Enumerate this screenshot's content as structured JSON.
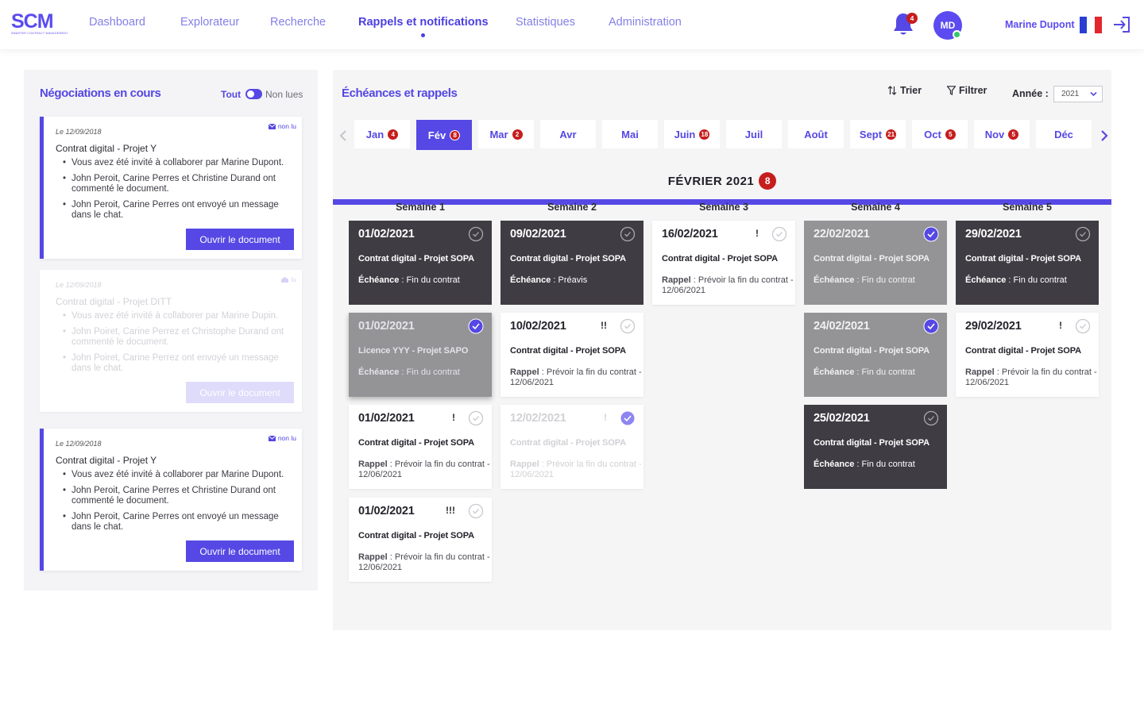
{
  "app": {
    "logo_text": "SCM",
    "logo_subtitle": "SMARTER CONTRACT MANAGEMENT"
  },
  "nav": [
    {
      "label": "Dashboard",
      "active": false
    },
    {
      "label": "Explorateur",
      "active": false
    },
    {
      "label": "Recherche",
      "active": false
    },
    {
      "label": "Rappels et notifications",
      "active": true
    },
    {
      "label": "Statistiques",
      "active": false
    },
    {
      "label": "Administration",
      "active": false
    }
  ],
  "header": {
    "notification_count": "4",
    "avatar_initials": "MD",
    "user_name": "Marine Dupont",
    "icons": {
      "bell": "bell-icon",
      "flag": "french-flag-icon",
      "logout": "logout-icon"
    }
  },
  "negotiations": {
    "title": "Négociations en cours",
    "filter_all": "Tout",
    "filter_unread": "Non lues",
    "cards": [
      {
        "date": "Le 12/09/2018",
        "unread_label": "non lu",
        "title": "Contrat digital - Projet Y",
        "items": [
          "Vous avez été invité à collaborer par Marine Dupont.",
          "John Peroit, Carine Perres et Christine Durand ont commenté le document.",
          "John Peroit, Carine Perres ont envoyé un message dans le chat."
        ],
        "button": "Ouvrir le document"
      },
      {
        "date": "Le 12/09/2018",
        "unread_label": "lu",
        "title": "Contrat digital - Projet DITT",
        "items": [
          "Vous avez été invité à collaborer par Marine Dupin.",
          "John Poiret, Carine Perrez et Christophe Durand ont commenté le document.",
          "John Poiret, Carine Perrez ont envoyé un message dans le chat."
        ],
        "button": "Ouvrir le document"
      },
      {
        "date": "Le 12/09/2018",
        "unread_label": "non lu",
        "title": "Contrat digital - Projet Y",
        "items": [
          "Vous avez été invité à collaborer par Marine Dupont.",
          "John Peroit, Carine Perres et Christine Durand ont commenté le document.",
          "John Peroit, Carine Perres ont envoyé un message dans le chat."
        ],
        "button": "Ouvrir le document"
      }
    ]
  },
  "schedule": {
    "title": "Échéances et rappels",
    "sort_label": "Trier",
    "filter_label": "Filtrer",
    "year_label": "Année :",
    "year_value": "2021",
    "months": [
      {
        "label": "Jan",
        "badge": "4",
        "active": false
      },
      {
        "label": "Fév",
        "badge": "8",
        "active": true
      },
      {
        "label": "Mar",
        "badge": "2",
        "active": false
      },
      {
        "label": "Avr",
        "badge": "",
        "active": false
      },
      {
        "label": "Mai",
        "badge": "",
        "active": false
      },
      {
        "label": "Juin",
        "badge": "18",
        "active": false
      },
      {
        "label": "Juil",
        "badge": "",
        "active": false
      },
      {
        "label": "Août",
        "badge": "",
        "active": false
      },
      {
        "label": "Sept",
        "badge": "21",
        "active": false
      },
      {
        "label": "Oct",
        "badge": "5",
        "active": false
      },
      {
        "label": "Nov",
        "badge": "5",
        "active": false
      },
      {
        "label": "Déc",
        "badge": "",
        "active": false
      }
    ],
    "month_heading": "FÉVRIER 2021",
    "month_count": "8",
    "weeks": [
      {
        "label": "Semaine 1",
        "events": [
          {
            "date": "01/02/2021",
            "style": "dark",
            "priority": "",
            "checked": false,
            "title": "Contrat digital - Projet SOPA",
            "desc_label": "Échéance",
            "desc_text": " : Fin du contrat"
          },
          {
            "date": "01/02/2021",
            "style": "grey-lifted",
            "priority": "",
            "checked": true,
            "title": "Licence YYY - Projet SAPO",
            "desc_label": "Échéance",
            "desc_text": " : Fin du contrat"
          },
          {
            "date": "01/02/2021",
            "style": "white",
            "priority": "!",
            "checked": false,
            "title": "Contrat digital - Projet SOPA",
            "desc_label": "Rappel",
            "desc_text": " : Prévoir la fin du contrat - 12/06/2021"
          },
          {
            "date": "01/02/2021",
            "style": "white",
            "priority": "!!!",
            "checked": false,
            "title": "Contrat digital - Projet SOPA",
            "desc_label": "Rappel",
            "desc_text": " : Prévoir la fin du contrat - 12/06/2021"
          }
        ]
      },
      {
        "label": "Semaine 2",
        "events": [
          {
            "date": "09/02/2021",
            "style": "dark",
            "priority": "",
            "checked": false,
            "title": "Contrat digital - Projet SOPA",
            "desc_label": "Échéance",
            "desc_text": " : Préavis"
          },
          {
            "date": "10/02/2021",
            "style": "white",
            "priority": "!!",
            "checked": false,
            "title": "Contrat digital - Projet SOPA",
            "desc_label": "Rappel",
            "desc_text": " : Prévoir la fin du contrat - 12/06/2021"
          },
          {
            "date": "12/02/2021",
            "style": "faded",
            "priority": "!",
            "checked": true,
            "title": "Contrat digital - Projet SOPA",
            "desc_label": "Rappel",
            "desc_text": " : Prévoir la fin du contrat - 12/06/2021"
          }
        ]
      },
      {
        "label": "Semaine 3",
        "events": [
          {
            "date": "16/02/2021",
            "style": "white",
            "priority": "!",
            "checked": false,
            "title": "Contrat digital - Projet SOPA",
            "desc_label": "Rappel",
            "desc_text": " : Prévoir la fin du contrat - 12/06/2021"
          }
        ]
      },
      {
        "label": "Semaine 4",
        "events": [
          {
            "date": "22/02/2021",
            "style": "grey",
            "priority": "",
            "checked": true,
            "title": "Contrat digital - Projet SOPA",
            "desc_label": "Échéance",
            "desc_text": " : Fin du contrat"
          },
          {
            "date": "24/02/2021",
            "style": "grey",
            "priority": "",
            "checked": true,
            "title": "Contrat digital - Projet SOPA",
            "desc_label": "Échéance",
            "desc_text": " : Fin du contrat"
          },
          {
            "date": "25/02/2021",
            "style": "dark",
            "priority": "",
            "checked": false,
            "title": "Contrat digital - Projet SOPA",
            "desc_label": "Échéance",
            "desc_text": " : Fin du contrat"
          }
        ]
      },
      {
        "label": "Semaine 5",
        "events": [
          {
            "date": "29/02/2021",
            "style": "dark",
            "priority": "",
            "checked": false,
            "title": "Contrat digital - Projet SOPA",
            "desc_label": "Échéance",
            "desc_text": " : Fin du contrat"
          },
          {
            "date": "29/02/2021",
            "style": "white",
            "priority": "!",
            "checked": false,
            "title": "Contrat digital - Projet SOPA",
            "desc_label": "Rappel",
            "desc_text": " : Prévoir la fin du contrat - 12/06/2021"
          }
        ]
      }
    ]
  },
  "colors": {
    "brand": "#5548e4",
    "badge_red": "#c61d1d",
    "card_dark": "#403c44",
    "card_grey": "#949396",
    "status_online": "#33c76b"
  }
}
